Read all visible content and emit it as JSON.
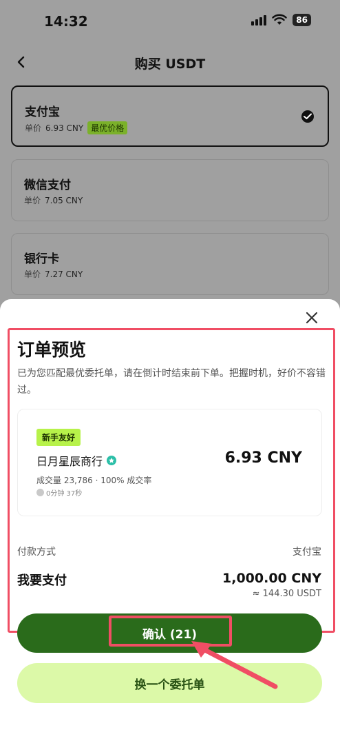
{
  "status_bar": {
    "time": "14:32",
    "battery": "86"
  },
  "nav": {
    "title": "购买 USDT"
  },
  "payment_methods": [
    {
      "name": "支付宝",
      "price_label": "单价",
      "price": "6.93 CNY",
      "badge": "最优价格"
    },
    {
      "name": "微信支付",
      "price_label": "单价",
      "price": "7.05 CNY"
    },
    {
      "name": "银行卡",
      "price_label": "单价",
      "price": "7.27 CNY"
    }
  ],
  "sheet": {
    "title": "订单预览",
    "description": "已为您匹配最优委托单，请在倒计时结束前下单。把握时机，好价不容错过。",
    "merchant": {
      "badge": "新手友好",
      "name": "日月星辰商行",
      "price": "6.93 CNY",
      "stats": "成交量 23,786 · 100% 成交率",
      "time": "0分钟 37秒"
    },
    "payment_method_label": "付款方式",
    "payment_method_value": "支付宝",
    "pay_label": "我要支付",
    "pay_amount": "1,000.00 CNY",
    "pay_approx": "≈ 144.30 USDT",
    "confirm_label": "确认 (21)",
    "change_label": "换一个委托单"
  },
  "colors": {
    "accent_dark": "#2a6b1b",
    "accent_light": "#dcf9a8",
    "highlight": "#f04e64"
  }
}
